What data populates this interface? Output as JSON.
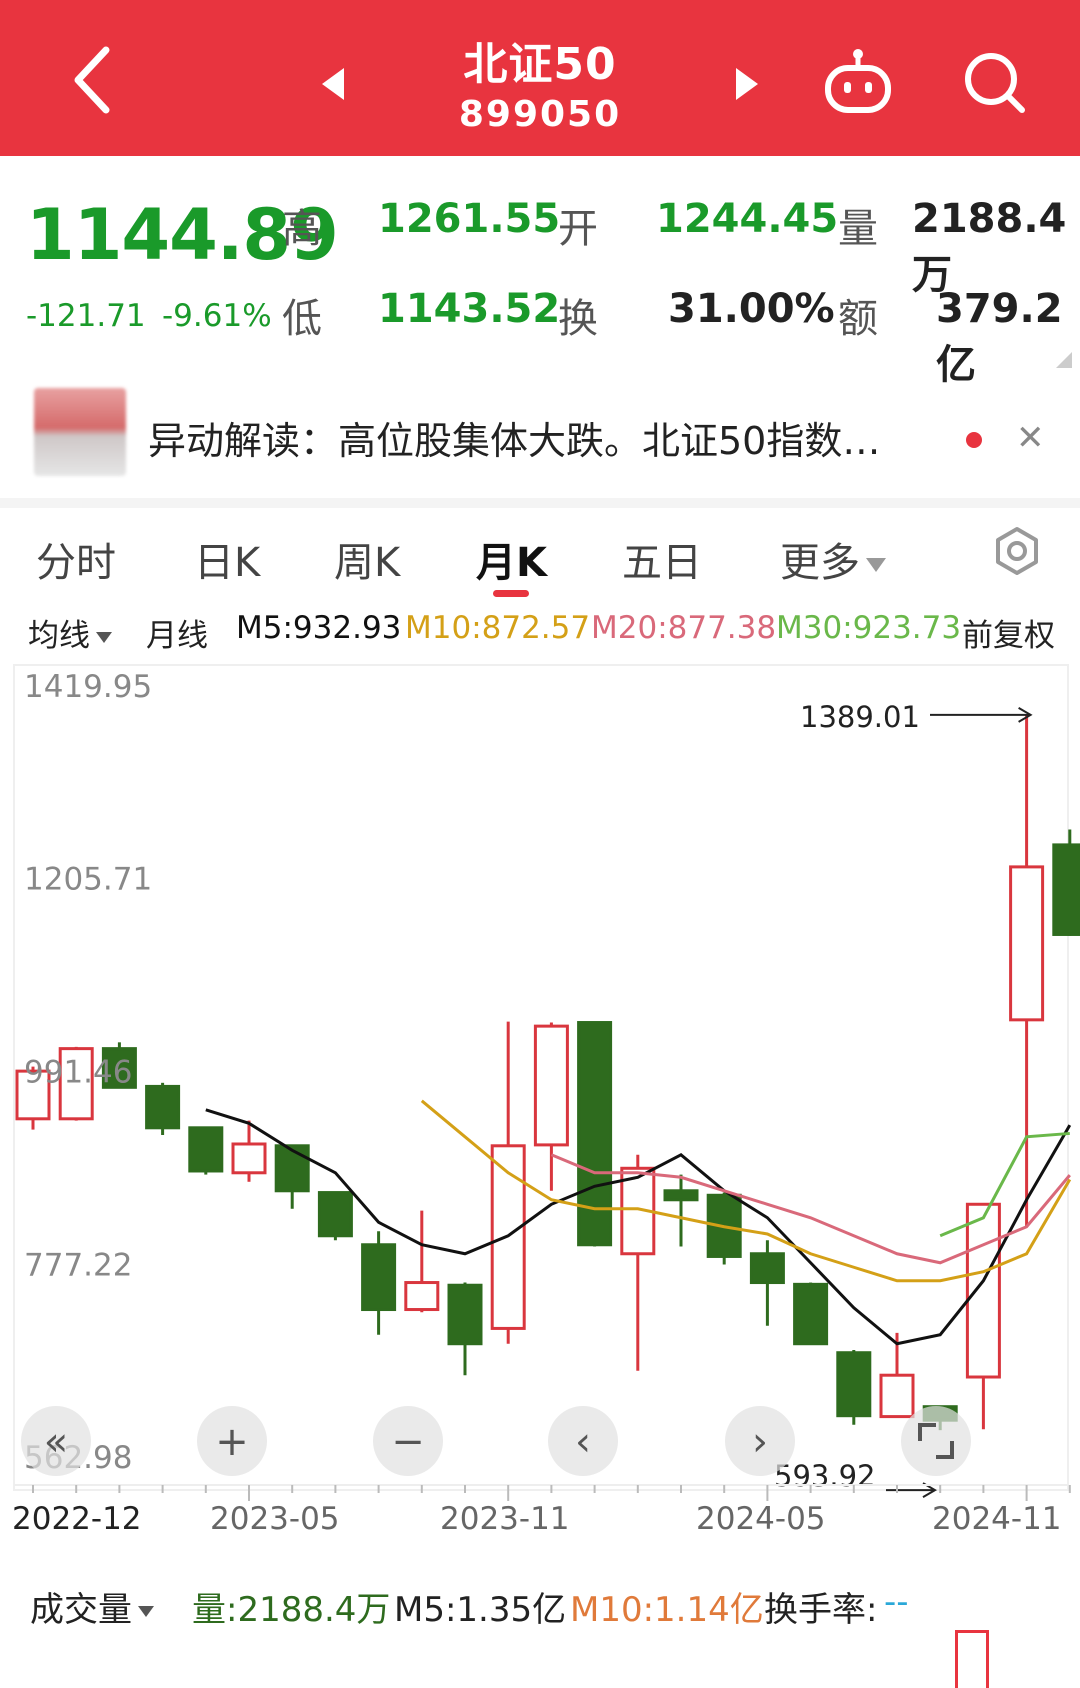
{
  "header": {
    "title": "北证50",
    "code": "899050",
    "background": "#e8343f"
  },
  "quote": {
    "price": "1144.89",
    "change": "-121.71",
    "change_pct": "-9.61%",
    "high_label": "高",
    "high": "1261.55",
    "open_label": "开",
    "open": "1244.45",
    "volume_label": "量",
    "volume": "2188.4万",
    "low_label": "低",
    "low": "1143.52",
    "turnover_label": "换",
    "turnover": "31.00%",
    "amount_label": "额",
    "amount": "379.2亿"
  },
  "news": {
    "text": "异动解读：高位股集体大跌。北证50指数…"
  },
  "tabs": [
    "分时",
    "日K",
    "周K",
    "月K",
    "五日",
    "更多"
  ],
  "active_tab": "月K",
  "ma": {
    "selector": "均线",
    "period": "月线",
    "m5": "M5:932.93",
    "m10": "M10:872.57",
    "m20": "M20:877.38",
    "m30": "M30:923.73",
    "adjust": "前复权"
  },
  "chart_data": {
    "type": "candlestick",
    "ytick_labels": [
      "1419.95",
      "1205.71",
      "991.46",
      "777.22",
      "562.98"
    ],
    "ylim": [
      562.98,
      1419.95
    ],
    "x_labels": [
      "2022-12",
      "2023-05",
      "2023-11",
      "2024-05",
      "2024-11"
    ],
    "max_annotation": "1389.01",
    "min_annotation": "593.92",
    "candles": [
      {
        "o": 940,
        "h": 998,
        "l": 928,
        "c": 993
      },
      {
        "o": 940,
        "h": 1020,
        "l": 938,
        "c": 1018
      },
      {
        "o": 1018,
        "h": 1025,
        "l": 975,
        "c": 975
      },
      {
        "o": 976,
        "h": 980,
        "l": 922,
        "c": 930
      },
      {
        "o": 930,
        "h": 930,
        "l": 878,
        "c": 882
      },
      {
        "o": 880,
        "h": 938,
        "l": 870,
        "c": 912
      },
      {
        "o": 910,
        "h": 910,
        "l": 840,
        "c": 860
      },
      {
        "o": 858,
        "h": 858,
        "l": 805,
        "c": 810
      },
      {
        "o": 800,
        "h": 815,
        "l": 700,
        "c": 728
      },
      {
        "o": 728,
        "h": 838,
        "l": 725,
        "c": 758
      },
      {
        "o": 755,
        "h": 758,
        "l": 655,
        "c": 690
      },
      {
        "o": 707,
        "h": 1048,
        "l": 690,
        "c": 910
      },
      {
        "o": 911,
        "h": 1047,
        "l": 860,
        "c": 1043
      },
      {
        "o": 1047,
        "h": 1048,
        "l": 798,
        "c": 800
      },
      {
        "o": 790,
        "h": 900,
        "l": 660,
        "c": 885
      },
      {
        "o": 860,
        "h": 878,
        "l": 798,
        "c": 850
      },
      {
        "o": 855,
        "h": 858,
        "l": 778,
        "c": 787
      },
      {
        "o": 790,
        "h": 805,
        "l": 710,
        "c": 758
      },
      {
        "o": 756,
        "h": 758,
        "l": 690,
        "c": 690
      },
      {
        "o": 680,
        "h": 683,
        "l": 600,
        "c": 610
      },
      {
        "o": 609,
        "h": 702,
        "l": 608,
        "c": 655
      },
      {
        "o": 620,
        "h": 618,
        "l": 593.92,
        "c": 605
      },
      {
        "o": 653,
        "h": 820,
        "l": 595,
        "c": 845
      },
      {
        "o": 1050,
        "h": 1389.01,
        "l": 820,
        "c": 1220
      },
      {
        "o": 1244.45,
        "h": 1261.55,
        "l": 1143.52,
        "c": 1144.89
      }
    ],
    "ma5": [
      null,
      null,
      null,
      null,
      950,
      935,
      905,
      880,
      825,
      800,
      790,
      810,
      845,
      865,
      875,
      900,
      860,
      830,
      780,
      730,
      690,
      700,
      760,
      850,
      932.93
    ],
    "ma10": [
      null,
      null,
      null,
      null,
      null,
      null,
      null,
      null,
      null,
      960,
      920,
      880,
      850,
      840,
      840,
      830,
      820,
      812,
      790,
      775,
      760,
      760,
      770,
      790,
      872.57
    ],
    "ma20": [
      null,
      null,
      null,
      null,
      null,
      null,
      null,
      null,
      null,
      null,
      null,
      null,
      900,
      880,
      880,
      875,
      860,
      845,
      830,
      810,
      790,
      780,
      800,
      820,
      877.38
    ],
    "ma30": [
      null,
      null,
      null,
      null,
      null,
      null,
      null,
      null,
      null,
      null,
      null,
      null,
      null,
      null,
      null,
      null,
      null,
      null,
      null,
      null,
      null,
      810,
      830,
      920,
      923.73
    ],
    "colors": {
      "up": "#d9363e",
      "down": "#2e6b1e",
      "ma5": "#111111",
      "ma10": "#d4a017",
      "ma20": "#d9697a",
      "ma30": "#6ab84a"
    },
    "nav_buttons": [
      "«",
      "+",
      "−",
      "‹",
      "›"
    ]
  },
  "volume": {
    "selector": "成交量",
    "vol": "量:2188.4万",
    "m5": "M5:1.35亿",
    "m10": "M10:1.14亿",
    "turnover_label": "换手率:",
    "turnover_value": "--"
  }
}
